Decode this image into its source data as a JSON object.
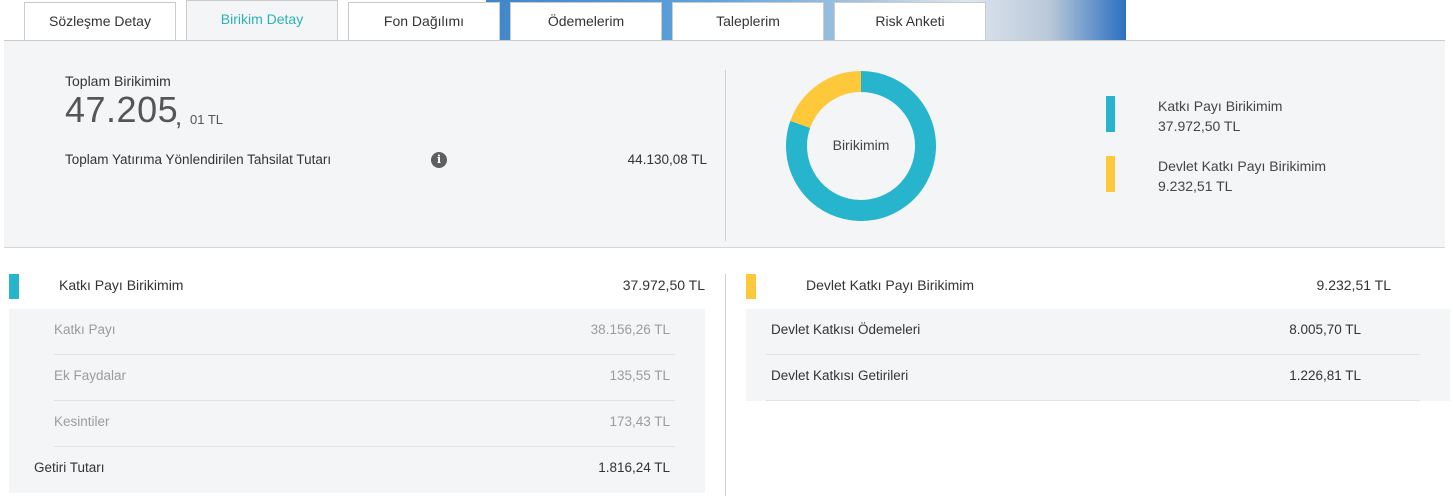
{
  "tabs": [
    {
      "label": "Sözleşme Detay",
      "active": false
    },
    {
      "label": "Birikim Detay",
      "active": true
    },
    {
      "label": "Fon Dağılımı",
      "active": false
    },
    {
      "label": "Ödemelerim",
      "active": false
    },
    {
      "label": "Taleplerim",
      "active": false
    },
    {
      "label": "Risk Anketi",
      "active": false
    }
  ],
  "summary": {
    "total_label": "Toplam Birikimim",
    "total_integer": "47.205",
    "total_comma": ",",
    "total_decimal": "01 TL",
    "directed_label": "Toplam Yatırıma Yönlendirilen Tahsilat Tutarı",
    "info_icon": "info-icon",
    "directed_value": "44.130,08 TL"
  },
  "chart_data": {
    "type": "pie",
    "donut": true,
    "center_label": "Birikimim",
    "series": [
      {
        "name": "Katkı Payı Birikimim",
        "value": 37972.5,
        "value_label": "37.972,50 TL",
        "color": "#27b5cd"
      },
      {
        "name": "Devlet Katkı Payı Birikimim",
        "value": 9232.51,
        "value_label": "9.232,51 TL",
        "color": "#fdc93b"
      }
    ]
  },
  "left_section": {
    "title": "Katkı Payı Birikimim",
    "value": "37.972,50 TL",
    "color": "#27b5cd",
    "rows": [
      {
        "label": "Katkı Payı",
        "value": "38.156,26 TL"
      },
      {
        "label": "Ek Faydalar",
        "value": "135,55 TL"
      },
      {
        "label": "Kesintiler",
        "value": "173,43 TL"
      }
    ],
    "footer": {
      "label": "Getiri Tutarı",
      "value": "1.816,24 TL"
    }
  },
  "right_section": {
    "title": "Devlet Katkı Payı Birikimim",
    "value": "9.232,51 TL",
    "color": "#fdc93b",
    "rows": [
      {
        "label": "Devlet Katkısı Ödemeleri",
        "value": "8.005,70 TL"
      },
      {
        "label": "Devlet Katkısı Getirileri",
        "value": "1.226,81 TL"
      }
    ]
  }
}
